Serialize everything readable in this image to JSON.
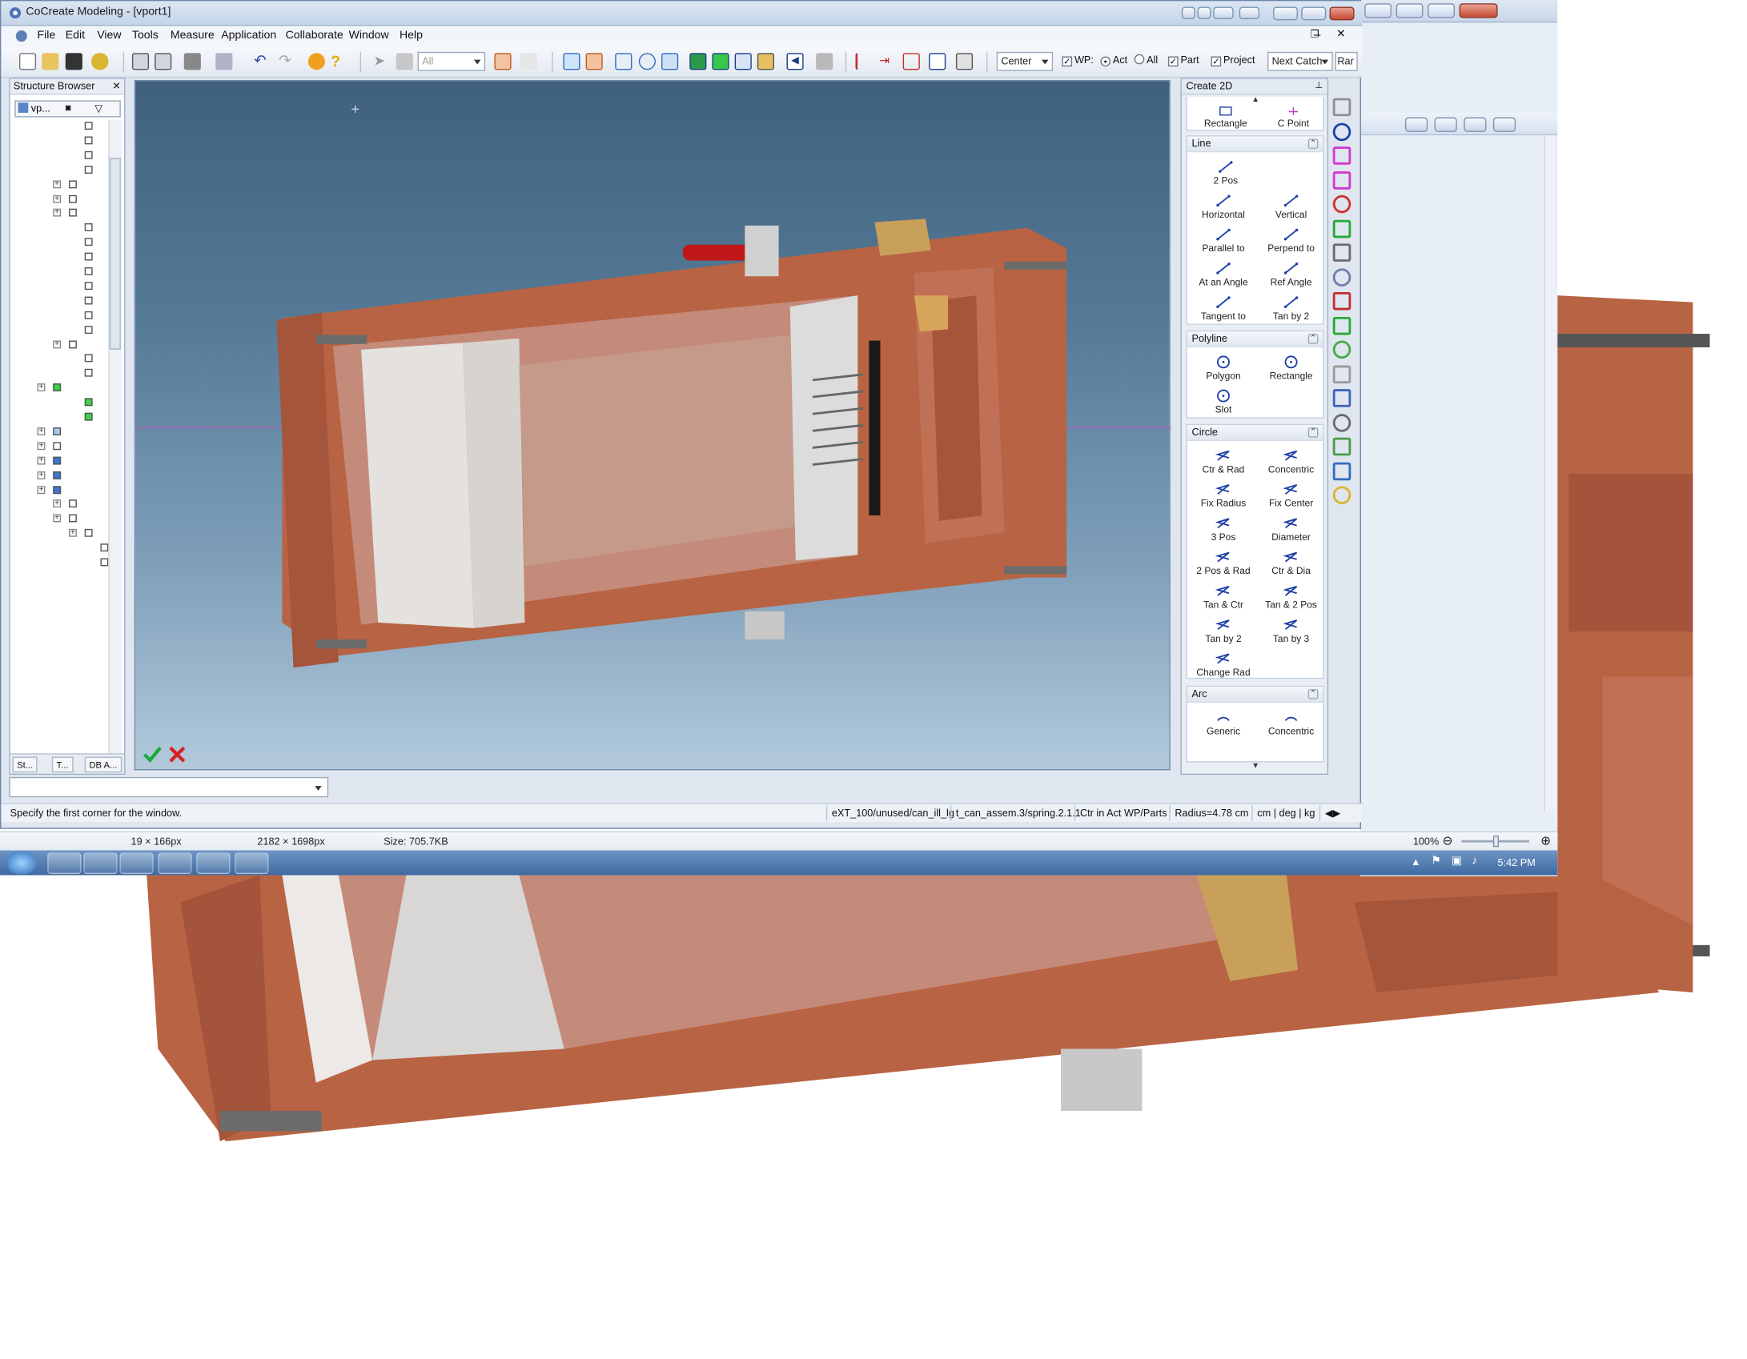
{
  "window": {
    "title": "CoCreate Modeling - [vport1]"
  },
  "menu": [
    "File",
    "Edit",
    "View",
    "Tools",
    "Measure",
    "Application",
    "Collaborate",
    "Window",
    "Help"
  ],
  "toolbar": {
    "filter_combo": "All",
    "center_combo": "Center",
    "wp_label": "WP:",
    "act_label": "Act",
    "all_label": "All",
    "part_label": "Part",
    "project_label": "Project",
    "next_catch_combo": "Next Catch",
    "rar_label": "Rar"
  },
  "structure_browser": {
    "title": "Structure Browser",
    "filter_text": "vp...",
    "tabs": [
      "St...",
      "T...",
      "DB A..."
    ]
  },
  "create2d": {
    "title": "Create 2D",
    "top_tools": [
      "Rectangle",
      "C Point"
    ],
    "sections": [
      {
        "name": "Line",
        "tools": [
          "2 Pos",
          "Horizontal",
          "Vertical",
          "Parallel to",
          "Perpend to",
          "At an Angle",
          "Ref Angle",
          "Tangent to",
          "Tan by 2"
        ]
      },
      {
        "name": "Polyline",
        "tools": [
          "Polygon",
          "Rectangle",
          "Slot"
        ]
      },
      {
        "name": "Circle",
        "tools": [
          "Ctr & Rad",
          "Concentric",
          "Fix Radius",
          "Fix Center",
          "3 Pos",
          "Diameter",
          "2 Pos & Rad",
          "Ctr & Dia",
          "Tan & Ctr",
          "Tan & 2 Pos",
          "Tan by 2",
          "Tan by 3",
          "Change Rad"
        ]
      },
      {
        "name": "Arc",
        "tools": [
          "Generic",
          "Concentric"
        ]
      }
    ]
  },
  "statusbar": {
    "message": "Specify the first corner for the window.",
    "fields": [
      "eXT_100/unused/can_ill_lg",
      "t_can_assem.3/spring.2.1.1",
      "Ctr in Act WP/Parts",
      "Radius=4.78 cm",
      "cm | deg | kg"
    ]
  },
  "image_viewer": {
    "selection": "19 × 166px",
    "dimensions": "2182 × 1698px",
    "size": "Size: 705.7KB",
    "zoom": "100%"
  },
  "taskbar": {
    "clock": "5:42 PM"
  },
  "colors": {
    "copper": "#b86343",
    "viewport_top": "#3f617d",
    "viewport_bottom": "#b2c9db",
    "accent_blue": "#1f3fa8"
  }
}
